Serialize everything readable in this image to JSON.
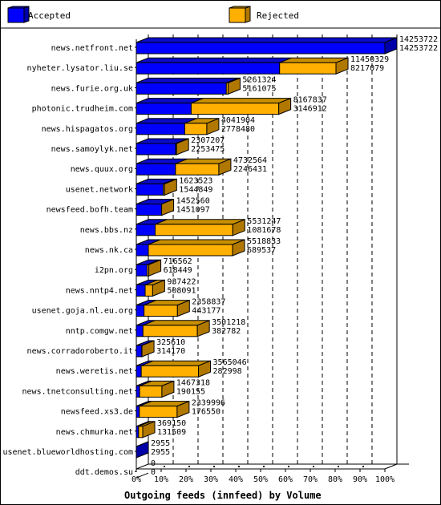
{
  "chart_data": {
    "type": "bar",
    "subtype": "horizontal-stacked-3d",
    "title": "Outgoing feeds (innfeed) by Volume",
    "xlabel": "",
    "ylabel": "",
    "xlim": [
      0,
      100
    ],
    "x_unit": "% of max offered volume",
    "grid": true,
    "legend_position": "top",
    "x_tick_labels": [
      "0%",
      "10%",
      "20%",
      "30%",
      "40%",
      "50%",
      "60%",
      "70%",
      "80%",
      "90%",
      "100%"
    ],
    "colors": {
      "accepted": "#0000ff",
      "rejected": "#ffb000"
    },
    "legend": [
      {
        "name": "Accepted",
        "color": "#0000ff"
      },
      {
        "name": "Rejected",
        "color": "#ffb000"
      }
    ],
    "categories": [
      "news.netfront.net",
      "nyheter.lysator.liu.se",
      "news.furie.org.uk",
      "photonic.trudheim.com",
      "news.hispagatos.org",
      "news.samoylyk.net",
      "news.quux.org",
      "usenet.network",
      "newsfeed.bofh.team",
      "news.bbs.nz",
      "news.nk.ca",
      "i2pn.org",
      "news.nntp4.net",
      "usenet.goja.nl.eu.org",
      "nntp.comgw.net",
      "news.corradoroberto.it",
      "news.weretis.net",
      "news.tnetconsulting.net",
      "newsfeed.xs3.de",
      "news.chmurka.net",
      "usenet.blueworldhosting.com",
      "ddt.demos.su"
    ],
    "totals": [
      14253722,
      11450329,
      5261324,
      8167837,
      4041904,
      2307207,
      4732564,
      1623523,
      1452560,
      5531247,
      5518833,
      716562,
      937422,
      2358837,
      3501218,
      325610,
      3565046,
      1467318,
      2339996,
      369150,
      2955,
      0
    ],
    "series": [
      {
        "name": "Accepted",
        "values": [
          14253722,
          8217079,
          5161075,
          3146912,
          2778480,
          2253475,
          2246431,
          1544849,
          1451097,
          1081678,
          689537,
          618449,
          508091,
          443177,
          382782,
          314170,
          282998,
          190155,
          176550,
          131509,
          2955,
          0
        ]
      },
      {
        "name": "Rejected",
        "values": [
          0,
          3233250,
          100249,
          5020925,
          1263424,
          53732,
          2486133,
          78674,
          1463,
          4449569,
          4829296,
          98113,
          429331,
          1915660,
          3118436,
          11440,
          3282048,
          1277163,
          2163446,
          237641,
          0,
          0
        ]
      }
    ]
  }
}
